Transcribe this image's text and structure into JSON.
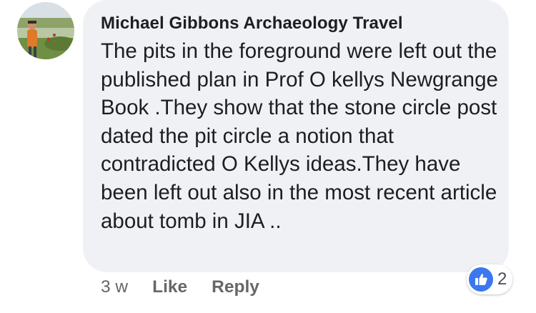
{
  "comment": {
    "author": "Michael Gibbons Archaeology Travel",
    "text": "The pits in the foreground were left out the published plan in Prof O kellys Newgrange Book .They show that the stone circle post dated the pit circle a notion that contradicted O Kellys ideas.They have been left out also in the most recent article about tomb in JIA ..",
    "timestamp": "3 w",
    "actions": {
      "like": "Like",
      "reply": "Reply"
    },
    "reactions": {
      "icon": "thumbs-up-icon",
      "count": "2",
      "color": "#3b78f0"
    }
  },
  "colors": {
    "bubble": "#f0f1f4",
    "text": "#1c1e21",
    "meta": "#65676b"
  }
}
